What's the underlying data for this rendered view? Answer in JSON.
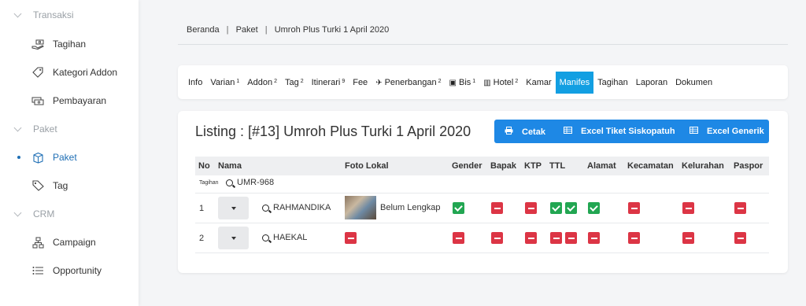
{
  "sidebar": {
    "sections": [
      {
        "label": "Transaksi"
      },
      {
        "label": "Paket"
      },
      {
        "label": "CRM"
      }
    ],
    "items": [
      {
        "label": "Tagihan",
        "icon": "hand-money-icon"
      },
      {
        "label": "Kategori Addon",
        "icon": "tag-icon"
      },
      {
        "label": "Pembayaran",
        "icon": "money-icon"
      },
      {
        "label": "Paket",
        "icon": "package-icon"
      },
      {
        "label": "Tag",
        "icon": "tag-icon"
      },
      {
        "label": "Campaign",
        "icon": "sitemap-icon"
      },
      {
        "label": "Opportunity",
        "icon": "list-icon"
      }
    ],
    "active_item": "Paket"
  },
  "breadcrumb": {
    "home": "Beranda",
    "section": "Paket",
    "current": "Umroh Plus Turki 1 April 2020",
    "separator": "|"
  },
  "tabs": [
    {
      "label": "Info"
    },
    {
      "label": "Varian",
      "count": "1"
    },
    {
      "label": "Addon",
      "count": "2"
    },
    {
      "label": "Tag",
      "count": "2"
    },
    {
      "label": "Itinerari",
      "count": "9"
    },
    {
      "label": "Fee"
    },
    {
      "label": "Penerbangan",
      "count": "2",
      "icon": "plane-icon"
    },
    {
      "label": "Bis",
      "count": "1",
      "icon": "bus-icon"
    },
    {
      "label": "Hotel",
      "count": "2",
      "icon": "hotel-icon"
    },
    {
      "label": "Kamar"
    },
    {
      "label": "Manifes",
      "active": true
    },
    {
      "label": "Tagihan"
    },
    {
      "label": "Laporan"
    },
    {
      "label": "Dokumen"
    }
  ],
  "listing": {
    "title": "Listing : [#13] Umroh Plus Turki 1 April 2020",
    "actions": [
      {
        "label": "Cetak",
        "icon": "print-icon"
      },
      {
        "label": "Excel Tiket Siskopatuh",
        "icon": "table-icon"
      },
      {
        "label": "Excel Generik",
        "icon": "table-icon"
      }
    ]
  },
  "table": {
    "headers": [
      "No",
      "Nama",
      "Foto Lokal",
      "Gender",
      "Bapak",
      "KTP",
      "TTL",
      "Alamat",
      "Kecamatan",
      "Kelurahan",
      "Paspor"
    ],
    "group": {
      "label": "Tagihan",
      "value": "UMR-968"
    },
    "rows": [
      {
        "no": "1",
        "name": "RAHMANDIKA",
        "photo_status": "Belum Lengkap",
        "has_photo": true,
        "gender": [
          "ok"
        ],
        "bapak": [
          "no"
        ],
        "ktp": [
          "no"
        ],
        "ttl": [
          "ok",
          "ok"
        ],
        "alamat": [
          "ok"
        ],
        "kecamatan": [
          "no"
        ],
        "kelurahan": [
          "no"
        ],
        "paspor": [
          "no"
        ]
      },
      {
        "no": "2",
        "name": "HAEKAL",
        "photo_status": "",
        "has_photo": false,
        "foto": [
          "no"
        ],
        "gender": [
          "no"
        ],
        "bapak": [
          "no"
        ],
        "ktp": [
          "no"
        ],
        "ttl": [
          "no",
          "no"
        ],
        "alamat": [
          "no"
        ],
        "kecamatan": [
          "no"
        ],
        "kelurahan": [
          "no"
        ],
        "paspor": [
          "no"
        ]
      }
    ]
  },
  "colors": {
    "accent": "#129fe2",
    "button": "#1e88e5",
    "ok": "#22a652",
    "missing": "#dc3545"
  }
}
